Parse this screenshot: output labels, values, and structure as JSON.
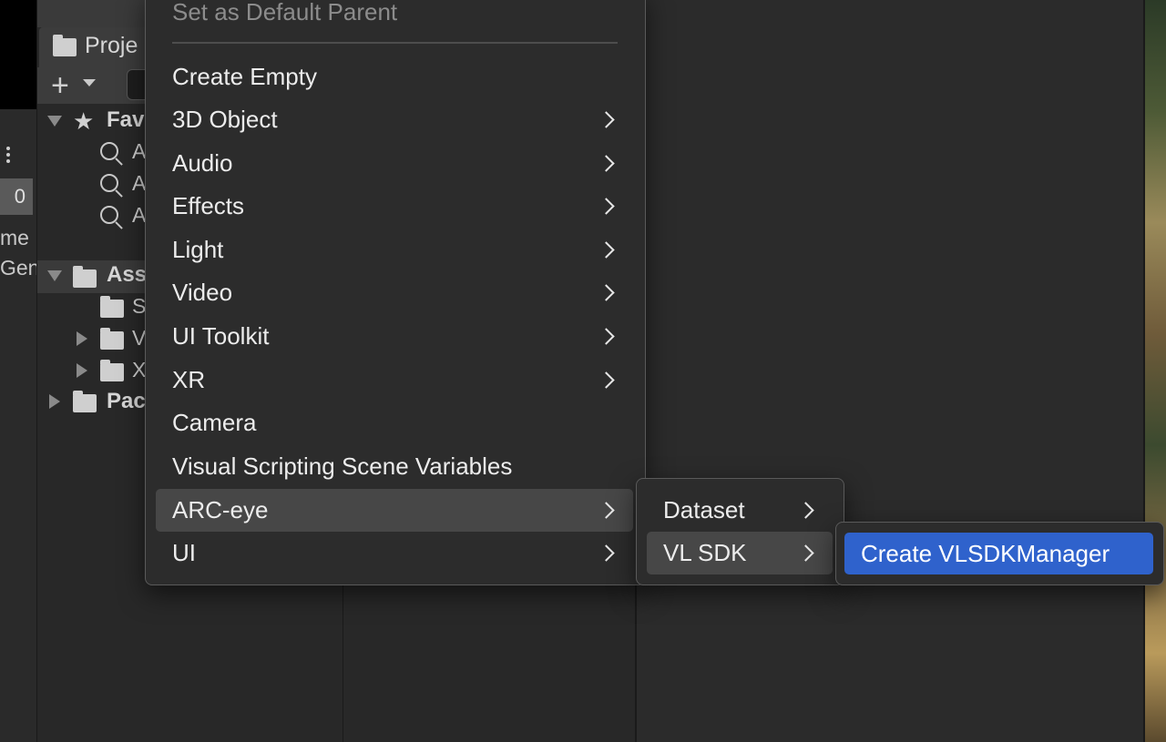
{
  "project_panel": {
    "tab_label": "Proje",
    "tree": {
      "favorites_label": "Fav",
      "favorites_items": [
        "A",
        "A",
        "A"
      ],
      "assets_label": "Ass",
      "assets_children": [
        "S",
        "V",
        "X"
      ],
      "packages_label": "Pac"
    }
  },
  "left_strip": {
    "counter": "0",
    "cut_text_1": "me",
    "cut_text_2": "Gen"
  },
  "context_menu": {
    "disabled_item": "Set as Default Parent",
    "items": [
      {
        "label": "Create Empty"
      },
      {
        "label": "3D Object"
      },
      {
        "label": "Audio"
      },
      {
        "label": "Effects"
      },
      {
        "label": "Light"
      },
      {
        "label": "Video"
      },
      {
        "label": "UI Toolkit"
      },
      {
        "label": "XR"
      },
      {
        "label": "Camera"
      },
      {
        "label": "Visual Scripting Scene Variables"
      },
      {
        "label": "ARC-eye"
      },
      {
        "label": "UI"
      }
    ]
  },
  "submenu_arc_eye": {
    "items": [
      {
        "label": "Dataset"
      },
      {
        "label": "VL SDK"
      }
    ]
  },
  "submenu_vl_sdk": {
    "items": [
      {
        "label": "Create VLSDKManager"
      }
    ]
  },
  "colors": {
    "selection": "#2f62cc",
    "hover": "#474747",
    "menu_bg": "#2c2c2c"
  }
}
